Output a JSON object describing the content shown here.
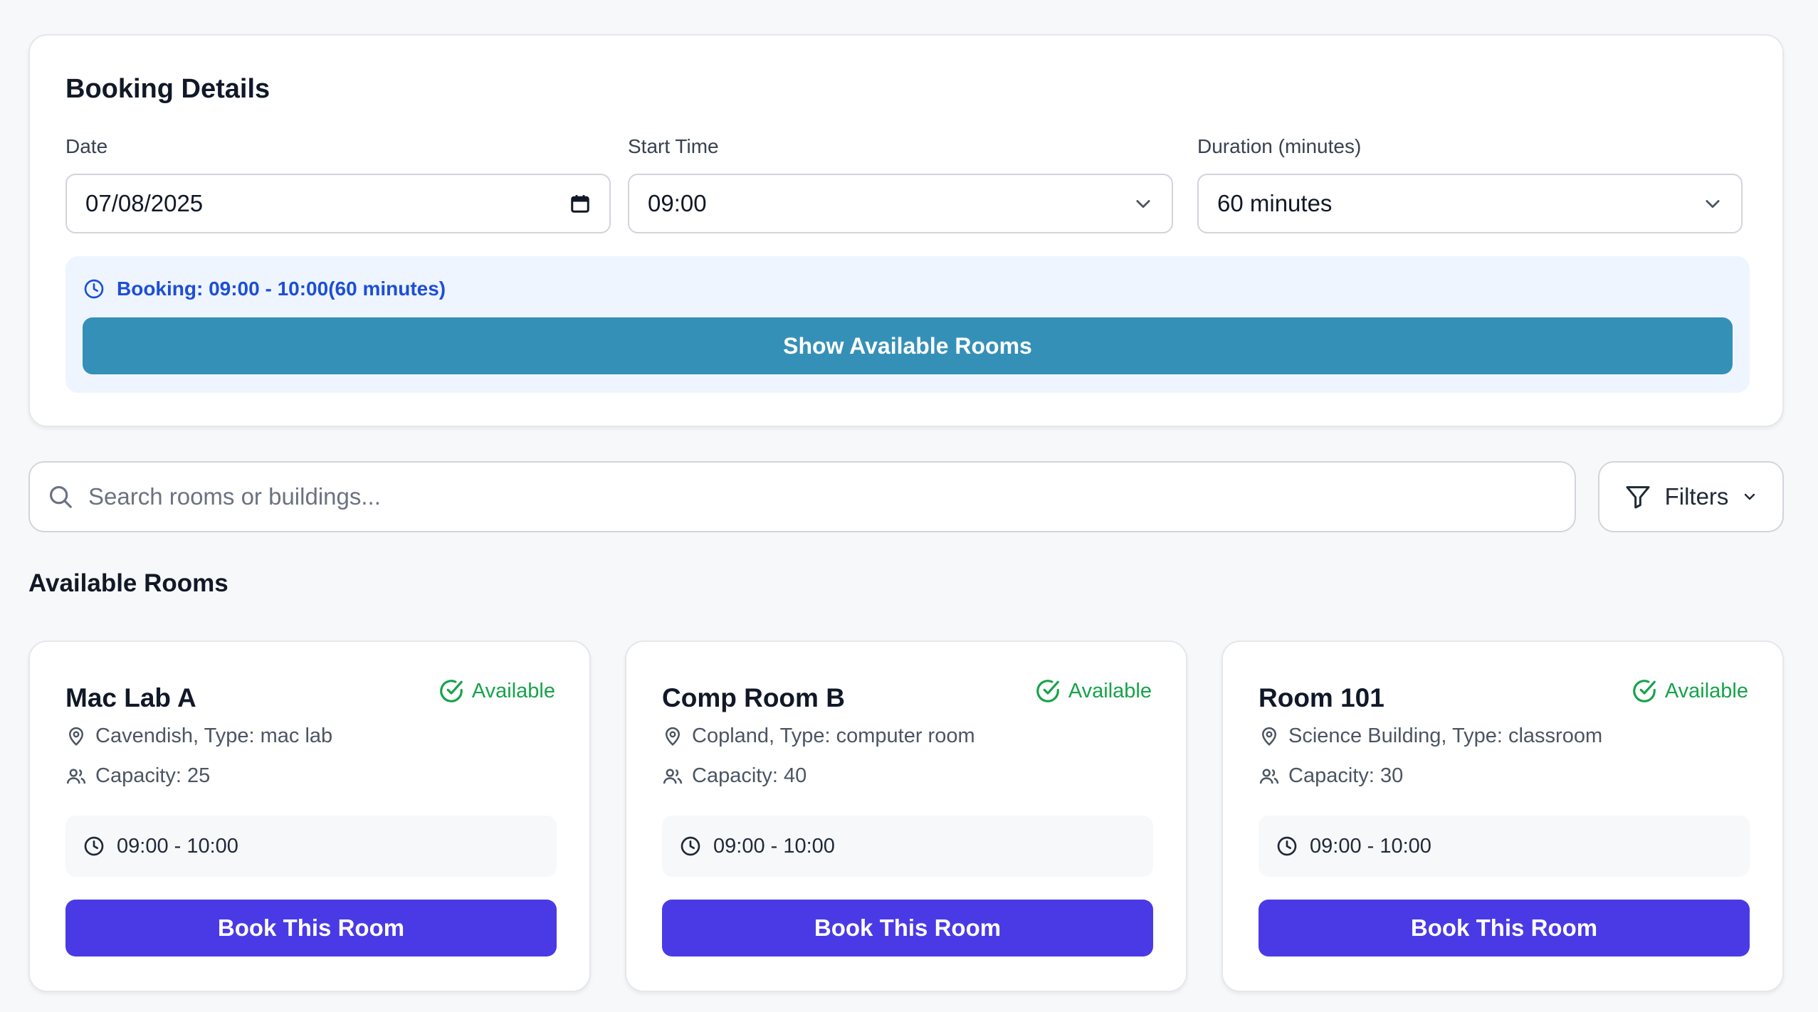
{
  "booking": {
    "title": "Booking Details",
    "date": {
      "label": "Date",
      "value": "07/08/2025"
    },
    "start_time": {
      "label": "Start Time",
      "value": "09:00"
    },
    "duration": {
      "label": "Duration (minutes)",
      "value": "60 minutes"
    },
    "summary": "Booking: 09:00 - 10:00(60 minutes)",
    "show_rooms_label": "Show Available Rooms"
  },
  "search": {
    "placeholder": "Search rooms or buildings...",
    "filters_label": "Filters"
  },
  "rooms_section": {
    "title": "Available Rooms",
    "book_label": "Book This Room",
    "rooms": [
      {
        "name": "Mac Lab A",
        "status": "Available",
        "location": "Cavendish, Type: mac lab",
        "capacity": "Capacity: 25",
        "time": "09:00 - 10:00"
      },
      {
        "name": "Comp Room B",
        "status": "Available",
        "location": "Copland, Type: computer room",
        "capacity": "Capacity: 40",
        "time": "09:00 - 10:00"
      },
      {
        "name": "Room 101",
        "status": "Available",
        "location": "Science Building, Type: classroom",
        "capacity": "Capacity: 30",
        "time": "09:00 - 10:00"
      }
    ]
  },
  "colors": {
    "primary_button": "#4a3ae6",
    "show_rooms_button": "#3590b8",
    "summary_text": "#1d4ed8",
    "available_green": "#16a34a"
  },
  "icons": {
    "calendar": "calendar-icon",
    "chevron": "chevron-down-icon",
    "clock": "clock-icon",
    "search": "search-icon",
    "filter": "filter-icon",
    "check": "check-circle-icon",
    "pin": "map-pin-icon",
    "users": "users-icon"
  }
}
